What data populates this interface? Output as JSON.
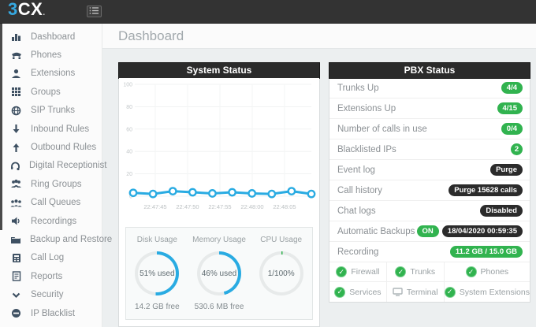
{
  "topbar": {
    "logo_blue": "3",
    "logo_rest": "CX",
    "logo_dot": ".",
    "bg_color": "#333333",
    "accent_blue": "#36a9e1"
  },
  "page_title": "Dashboard",
  "sidebar": {
    "items": [
      {
        "label": "Dashboard",
        "icon": "dashboard-icon"
      },
      {
        "label": "Phones",
        "icon": "phone-icon"
      },
      {
        "label": "Extensions",
        "icon": "person-icon"
      },
      {
        "label": "Groups",
        "icon": "grid-icon"
      },
      {
        "label": "SIP Trunks",
        "icon": "globe-icon"
      },
      {
        "label": "Inbound Rules",
        "icon": "arrow-down-icon"
      },
      {
        "label": "Outbound Rules",
        "icon": "arrow-up-icon"
      },
      {
        "label": "Digital Receptionist",
        "icon": "headset-icon"
      },
      {
        "label": "Ring Groups",
        "icon": "ring-groups-icon"
      },
      {
        "label": "Call Queues",
        "icon": "call-queues-icon"
      },
      {
        "label": "Recordings",
        "icon": "speaker-icon"
      },
      {
        "label": "Backup and Restore",
        "icon": "folder-icon"
      },
      {
        "label": "Call Log",
        "icon": "journal-icon"
      },
      {
        "label": "Reports",
        "icon": "report-icon"
      },
      {
        "label": "Security",
        "icon": "chevron-down-icon"
      },
      {
        "label": "IP Blacklist",
        "icon": "minus-circle-icon"
      }
    ]
  },
  "system_status": {
    "title": "System Status",
    "gauges": [
      {
        "title": "Disk Usage",
        "value": "51% used",
        "percent": 51,
        "sub": "14.2 GB free",
        "color": "#29abe2"
      },
      {
        "title": "Memory Usage",
        "value": "46% used",
        "percent": 46,
        "sub": "530.6 MB free",
        "color": "#29abe2"
      },
      {
        "title": "CPU Usage",
        "value": "1/100%",
        "percent": 1,
        "sub": "",
        "color": "#31b34f"
      }
    ]
  },
  "chart_data": {
    "type": "line",
    "title": "System Status",
    "x_tick_labels": [
      "22:47:45",
      "22:47:50",
      "22:47:55",
      "22:48:00",
      "22:48:05"
    ],
    "values": [
      3,
      2,
      4.5,
      3.5,
      2.5,
      3.5,
      2.5,
      2,
      4.5,
      2
    ],
    "ylim": [
      0,
      100
    ],
    "yticks": [
      0,
      20,
      40,
      60,
      80,
      100
    ],
    "line_color": "#29abe2",
    "marker": "open-circle",
    "grid": true,
    "legend": "none"
  },
  "pbx_status": {
    "title": "PBX Status",
    "rows": [
      {
        "label": "Trunks Up",
        "badges": [
          {
            "text": "4/4",
            "style": "green",
            "interactable": false
          }
        ]
      },
      {
        "label": "Extensions Up",
        "badges": [
          {
            "text": "4/15",
            "style": "green",
            "interactable": false
          }
        ]
      },
      {
        "label": "Number of calls in use",
        "badges": [
          {
            "text": "0/4",
            "style": "green",
            "interactable": false
          }
        ]
      },
      {
        "label": "Blacklisted IPs",
        "badges": [
          {
            "text": "2",
            "style": "green-circle",
            "interactable": false
          }
        ]
      },
      {
        "label": "Event log",
        "badges": [
          {
            "text": "Purge",
            "style": "dark",
            "interactable": true
          }
        ]
      },
      {
        "label": "Call history",
        "badges": [
          {
            "text": "Purge 15628 calls",
            "style": "dark",
            "interactable": true
          }
        ]
      },
      {
        "label": "Chat logs",
        "badges": [
          {
            "text": "Disabled",
            "style": "dark",
            "interactable": true
          }
        ]
      },
      {
        "label": "Automatic Backups",
        "badges": [
          {
            "text": "ON",
            "style": "green",
            "interactable": true
          },
          {
            "text": "18/04/2020 00:59:35",
            "style": "dark",
            "interactable": false
          }
        ]
      },
      {
        "label": "Recording",
        "badges": [
          {
            "text": "11.2 GB / 15.0 GB",
            "style": "green",
            "interactable": false
          }
        ]
      }
    ],
    "grid": [
      {
        "label": "Firewall",
        "icon": "check-circle-icon"
      },
      {
        "label": "Trunks",
        "icon": "check-circle-icon"
      },
      {
        "label": "Phones",
        "icon": "check-circle-icon"
      },
      {
        "label": "Services",
        "icon": "check-circle-icon"
      },
      {
        "label": "Terminal",
        "icon": "terminal-icon"
      },
      {
        "label": "System Extensions",
        "icon": "check-circle-icon"
      }
    ]
  },
  "colors": {
    "green": "#31b34f",
    "dark_badge": "#2b2b2b",
    "blue": "#29abe2",
    "main_bg": "#eceff0"
  }
}
